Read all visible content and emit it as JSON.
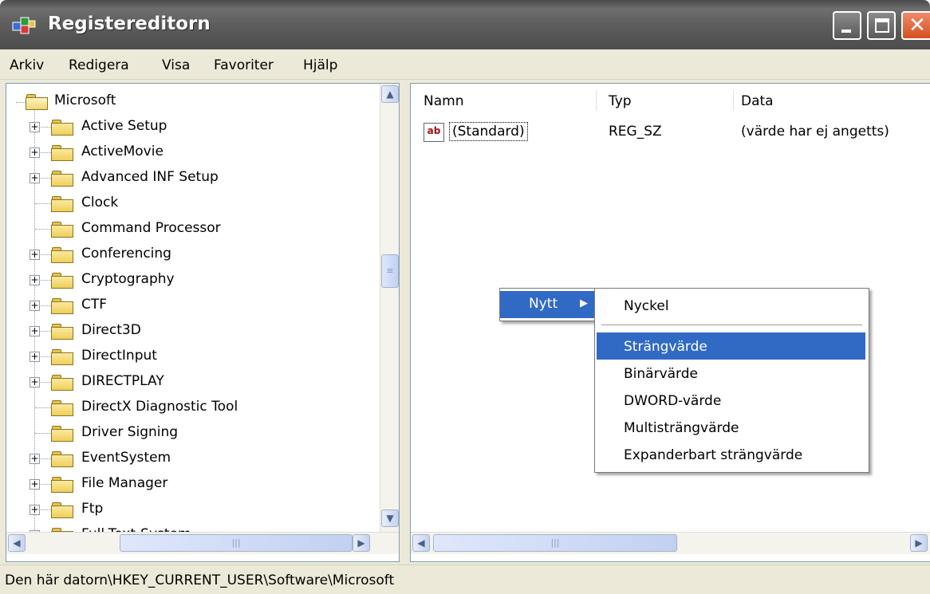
{
  "window": {
    "title": "Registereditorn",
    "close_glyph": "✕"
  },
  "menubar": {
    "items": [
      "Arkiv",
      "Redigera",
      "Visa",
      "Favoriter",
      "Hjälp"
    ]
  },
  "tree": {
    "root": "Microsoft",
    "items": [
      {
        "label": "Active Setup",
        "expandable": true
      },
      {
        "label": "ActiveMovie",
        "expandable": true
      },
      {
        "label": "Advanced INF Setup",
        "expandable": true
      },
      {
        "label": "Clock",
        "expandable": false
      },
      {
        "label": "Command Processor",
        "expandable": false
      },
      {
        "label": "Conferencing",
        "expandable": true
      },
      {
        "label": "Cryptography",
        "expandable": true
      },
      {
        "label": "CTF",
        "expandable": true
      },
      {
        "label": "Direct3D",
        "expandable": true
      },
      {
        "label": "DirectInput",
        "expandable": true
      },
      {
        "label": "DIRECTPLAY",
        "expandable": true
      },
      {
        "label": "DirectX Diagnostic Tool",
        "expandable": false
      },
      {
        "label": "Driver Signing",
        "expandable": false
      },
      {
        "label": "EventSystem",
        "expandable": true
      },
      {
        "label": "File Manager",
        "expandable": true
      },
      {
        "label": "Ftp",
        "expandable": true
      },
      {
        "label": "Full-Text-System",
        "expandable": true
      }
    ],
    "expand_glyph": "+"
  },
  "list": {
    "columns": [
      "Namn",
      "Typ",
      "Data"
    ],
    "rows": [
      {
        "icon": "ab",
        "name": "(Standard)",
        "type": "REG_SZ",
        "data": "(värde har ej angetts)"
      }
    ]
  },
  "scroll": {
    "up": "▲",
    "down": "▼",
    "left": "◀",
    "right": "▶",
    "grip_v": "≡",
    "grip_h": "|||"
  },
  "context_menu": {
    "parent_label": "Nytt",
    "parent_arrow": "▶",
    "submenu": {
      "first": "Nyckel",
      "items": [
        "Strängvärde",
        "Binärvärde",
        "DWORD-värde",
        "Multisträngvärde",
        "Expanderbart strängvärde"
      ],
      "active_index": 0
    }
  },
  "statusbar": {
    "path": "Den här datorn\\HKEY_CURRENT_USER\\Software\\Microsoft"
  },
  "colors": {
    "titlebar": "#5d5d5d",
    "menu_highlight": "#316ac5",
    "chrome": "#ece9d8"
  }
}
